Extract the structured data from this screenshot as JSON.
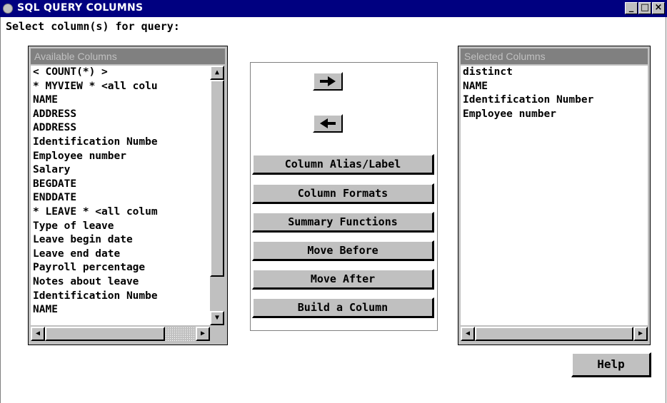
{
  "window": {
    "title": "SQL QUERY COLUMNS",
    "minimize_glyph": "_",
    "maximize_glyph": "□",
    "close_glyph": "×"
  },
  "prompt": "Select column(s) for query:",
  "available": {
    "header": "Available Columns",
    "items": [
      "< COUNT(*) >",
      "* MYVIEW * <all colu",
      "NAME",
      "ADDRESS",
      "ADDRESS",
      "Identification Numbe",
      "Employee number",
      "Salary",
      "BEGDATE",
      "ENDDATE",
      "* LEAVE * <all colum",
      "Type of leave",
      "Leave begin date",
      "Leave end date",
      "Payroll percentage",
      "Notes about leave",
      "Identification Numbe",
      "NAME"
    ]
  },
  "selected": {
    "header": "Selected Columns",
    "items": [
      "distinct",
      "NAME",
      "Identification Number",
      "Employee number"
    ]
  },
  "buttons": {
    "add_icon": "right-arrow-icon",
    "remove_icon": "left-arrow-icon",
    "alias": "Column Alias/Label",
    "formats": "Column Formats",
    "summary": "Summary Functions",
    "move_before": "Move Before",
    "move_after": "Move After",
    "build": "Build a Column",
    "help": "Help"
  },
  "colors": {
    "titlebar": "#000080",
    "face": "#c0c0c0",
    "header": "#808080"
  }
}
